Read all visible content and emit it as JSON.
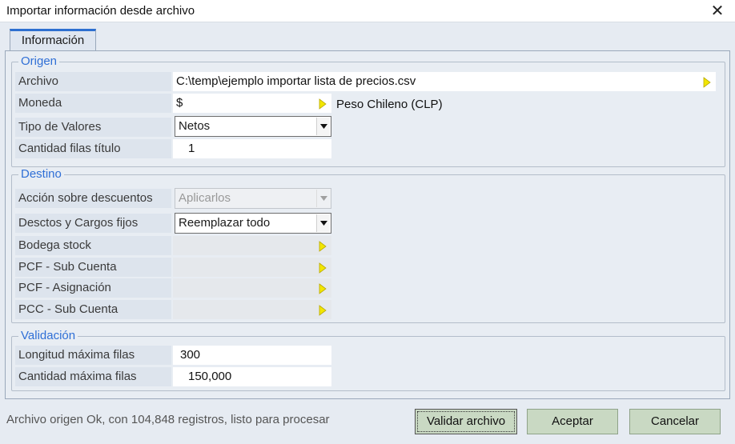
{
  "window": {
    "title": "Importar información desde archivo"
  },
  "tabs": [
    {
      "label": "Información"
    }
  ],
  "origen": {
    "legend": "Origen",
    "archivo_label": "Archivo",
    "archivo_value": "C:\\temp\\ejemplo importar lista de precios.csv",
    "moneda_label": "Moneda",
    "moneda_value": "$",
    "moneda_name": "Peso Chileno (CLP)",
    "tipo_label": "Tipo de Valores",
    "tipo_value": "Netos",
    "filas_titulo_label": "Cantidad filas título",
    "filas_titulo_value": "1"
  },
  "destino": {
    "legend": "Destino",
    "accion_label": "Acción sobre descuentos",
    "accion_value": "Aplicarlos",
    "desctos_label": "Desctos y Cargos fijos",
    "desctos_value": "Reemplazar todo",
    "bodega_label": "Bodega stock",
    "pcf_sub_label": "PCF - Sub Cuenta",
    "pcf_asig_label": "PCF - Asignación",
    "pcc_sub_label": "PCC - Sub Cuenta"
  },
  "validacion": {
    "legend": "Validación",
    "longitud_label": "Longitud máxima filas",
    "longitud_value": "300",
    "cantidad_label": "Cantidad máxima filas",
    "cantidad_value": "150,000"
  },
  "status_text": "Archivo origen Ok, con 104,848 registros, listo para procesar",
  "buttons": {
    "validar": "Validar archivo",
    "aceptar": "Aceptar",
    "cancelar": "Cancelar"
  },
  "colors": {
    "accent": "#2f6fd6",
    "button": "#c9d9c3",
    "arrow": "#f2e600"
  },
  "icons": {
    "close": "close-icon",
    "lookup": "lookup-arrow-icon",
    "dropdown": "chevron-down-icon"
  }
}
